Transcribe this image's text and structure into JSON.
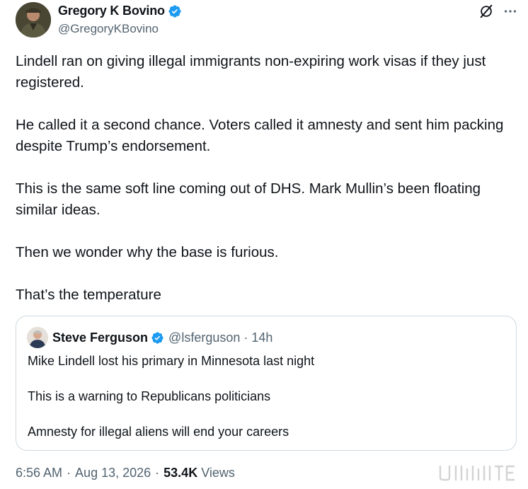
{
  "author": {
    "display_name": "Gregory K Bovino",
    "handle": "@GregoryKBovino"
  },
  "post": {
    "paragraphs": [
      "Lindell ran on giving illegal immigrants non-expiring work visas if they just registered.",
      "He called it a second chance. Voters called it amnesty and sent him packing despite Trump’s endorsement.",
      "This is the same soft line coming out of DHS. Mark Mullin’s been floating similar ideas.",
      "Then we wonder why the base is furious.",
      "That’s the temperature"
    ]
  },
  "quote": {
    "display_name": "Steve Ferguson",
    "handle": "@lsferguson",
    "separator": "·",
    "time": "14h",
    "paragraphs": [
      "Mike Lindell lost his primary in Minnesota last night",
      "This is a warning to Republicans politicians",
      "Amnesty for illegal aliens will end your careers"
    ]
  },
  "footer": {
    "time": "6:56 AM",
    "sep1": "·",
    "date": "Aug 13, 2026",
    "sep2": "·",
    "views_count": "53.4K",
    "views_label": "Views"
  },
  "icons": {
    "verified": "verified-badge-icon",
    "grok": "grok-icon",
    "more": "more-options-icon"
  },
  "colors": {
    "verified": "#1d9bf0",
    "text": "#0f1419",
    "secondary": "#536471",
    "border": "#cfd9de"
  }
}
